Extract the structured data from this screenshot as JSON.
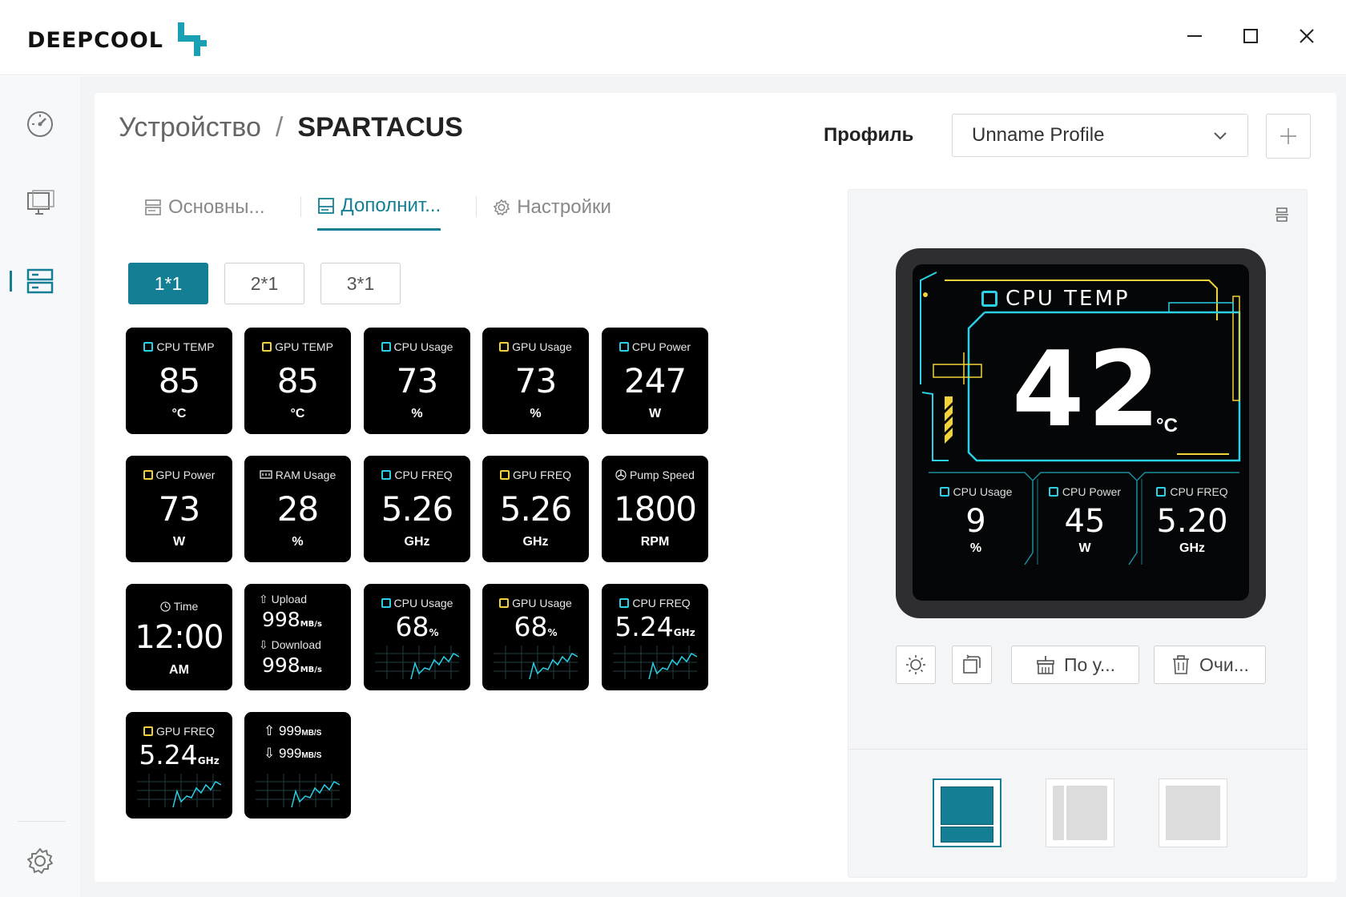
{
  "app": {
    "logo_text": "DeepCool",
    "brand_color": "#1aa0b4",
    "accent_color": "#147f94"
  },
  "window_controls": {
    "minimize_icon": "minimize-icon",
    "maximize_icon": "maximize-icon",
    "close_icon": "close-icon"
  },
  "sidebar": {
    "items": [
      {
        "icon": "speedometer-icon"
      },
      {
        "icon": "monitor-icon"
      },
      {
        "icon": "device-list-icon",
        "active": true
      }
    ],
    "settings_icon": "gear-icon"
  },
  "breadcrumb": {
    "section": "Устройство",
    "separator": "/",
    "device": "SPARTACUS"
  },
  "profile": {
    "label": "Профиль",
    "selected": "Unname Profile",
    "add_icon": "plus-icon"
  },
  "tabs": [
    {
      "label": "Основны...",
      "icon": "basic-icon"
    },
    {
      "label": "Дополнит...",
      "icon": "advanced-icon",
      "active": true
    },
    {
      "label": "Настройки",
      "icon": "gear-icon"
    }
  ],
  "size_buttons": [
    {
      "label": "1*1",
      "active": true
    },
    {
      "label": "2*1"
    },
    {
      "label": "3*1"
    }
  ],
  "widgets": [
    {
      "title": "CPU TEMP",
      "value": "85",
      "unit": "°C"
    },
    {
      "title": "GPU TEMP",
      "value": "85",
      "unit": "°C"
    },
    {
      "title": "CPU Usage",
      "value": "73",
      "unit": "%"
    },
    {
      "title": "GPU Usage",
      "value": "73",
      "unit": "%"
    },
    {
      "title": "CPU Power",
      "value": "247",
      "unit": "W"
    },
    {
      "title": "GPU Power",
      "value": "73",
      "unit": "W"
    },
    {
      "title": "RAM Usage",
      "value": "28",
      "unit": "%"
    },
    {
      "title": "CPU FREQ",
      "value": "5.26",
      "unit": "GHz"
    },
    {
      "title": "GPU FREQ",
      "value": "5.26",
      "unit": "GHz"
    },
    {
      "title": "Pump Speed",
      "value": "1800",
      "unit": "RPM"
    },
    {
      "title": "Time",
      "value": "12:00",
      "unit": "AM"
    },
    {
      "upload_label": "Upload",
      "upload_value": "998",
      "upload_unit": "MB/s",
      "download_label": "Download",
      "download_value": "998",
      "download_unit": "MB/s"
    },
    {
      "title": "CPU Usage",
      "value": "68",
      "unit": "%"
    },
    {
      "title": "GPU Usage",
      "value": "68",
      "unit": "%"
    },
    {
      "title": "CPU FREQ",
      "value": "5.24",
      "unit": "GHz"
    },
    {
      "title": "GPU FREQ",
      "value": "5.24",
      "unit": "GHz"
    },
    {
      "up_value": "999",
      "up_unit": "MB/S",
      "down_value": "999",
      "down_unit": "MB/S"
    }
  ],
  "preview": {
    "layout_icon": "layout-toggle-icon",
    "main_title": "CPU TEMP",
    "main_value": "42",
    "main_unit": "°C",
    "sub_widgets": [
      {
        "title": "CPU Usage",
        "value": "9",
        "unit": "%"
      },
      {
        "title": "CPU Power",
        "value": "45",
        "unit": "W"
      },
      {
        "title": "CPU FREQ",
        "value": "5.20",
        "unit": "GHz"
      }
    ]
  },
  "tools": {
    "brightness_icon": "brightness-icon",
    "rotate_icon": "rotate-icon",
    "default_label": "По у...",
    "default_icon": "reset-brush-icon",
    "clear_label": "Очи...",
    "clear_icon": "trash-icon"
  },
  "layouts": [
    {
      "name": "layout-top-bottom",
      "active": true
    },
    {
      "name": "layout-left-right"
    },
    {
      "name": "layout-full"
    }
  ]
}
